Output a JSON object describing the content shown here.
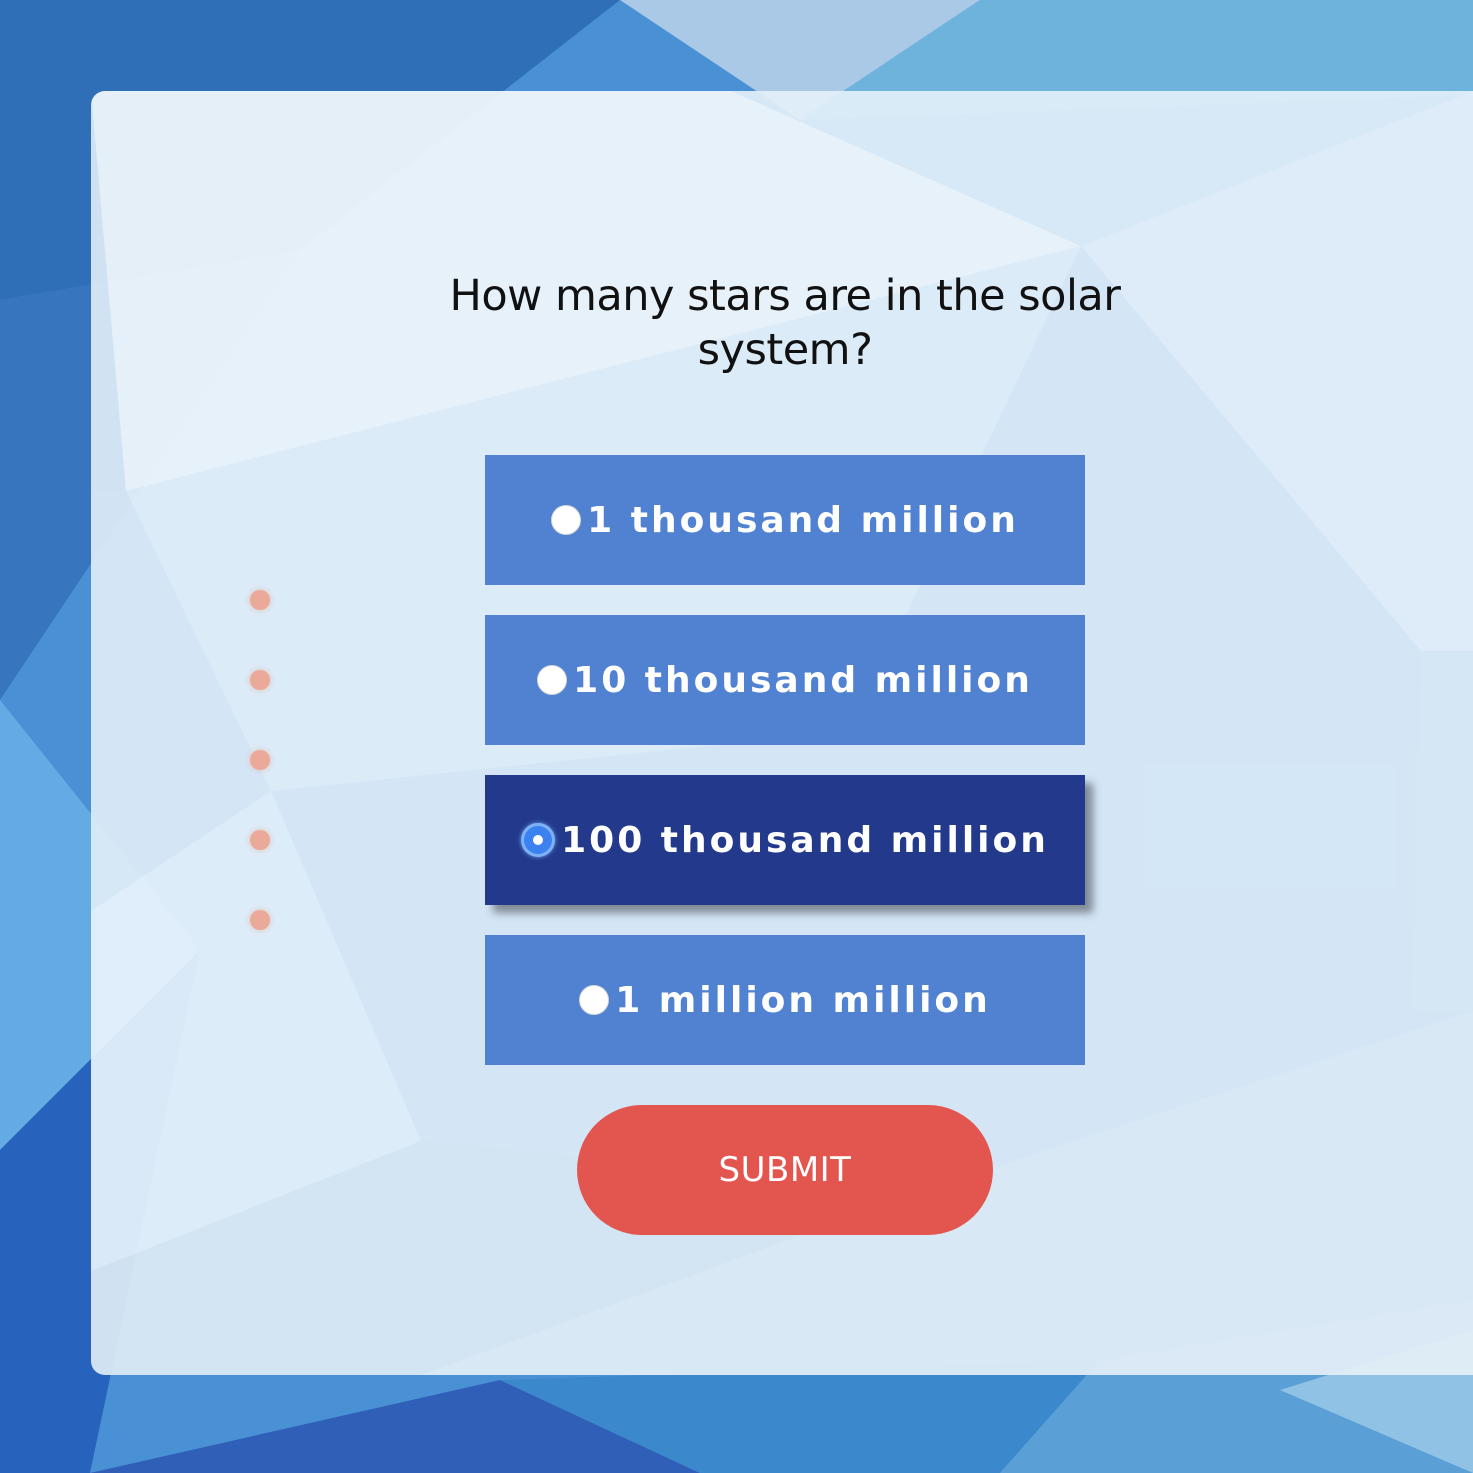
{
  "quiz": {
    "question": "How many stars are in the solar system?",
    "options": [
      {
        "label": "1 thousand million",
        "selected": false
      },
      {
        "label": "10 thousand million",
        "selected": false
      },
      {
        "label": "100 thousand million",
        "selected": true
      },
      {
        "label": "1 million million",
        "selected": false
      }
    ],
    "submit_label": "SUBMIT",
    "progress_dots": 5
  },
  "colors": {
    "option_bg": "#5082d1",
    "option_selected_bg": "#233a8c",
    "submit_bg": "#e35650",
    "dot": "#eba99a"
  }
}
